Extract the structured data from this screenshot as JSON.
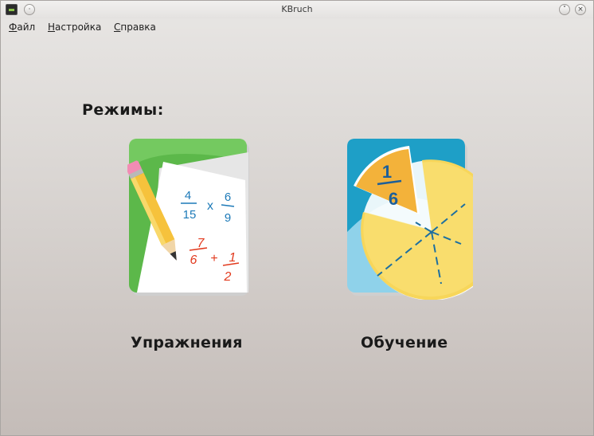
{
  "window": {
    "title": "KBruch"
  },
  "menu": {
    "items": [
      {
        "label": "Файл",
        "accel": "Ф",
        "rest": "айл"
      },
      {
        "label": "Настройка",
        "accel": "Н",
        "rest": "астройка"
      },
      {
        "label": "Справка",
        "accel": "С",
        "rest": "правка"
      }
    ]
  },
  "main": {
    "heading": "Режимы:",
    "modes": [
      {
        "label": "Упражнения",
        "icon": "exercise-pencil-paper-icon",
        "fractions": {
          "a_num": "4",
          "a_den": "15",
          "op1": "x",
          "b_num": "6",
          "b_den": "9",
          "c_num": "7",
          "c_den": "6",
          "op2": "+",
          "d_num": "1",
          "d_den": "2"
        }
      },
      {
        "label": "Обучение",
        "icon": "learning-pie-chart-icon",
        "fraction": {
          "num": "1",
          "den": "6"
        }
      }
    ]
  },
  "colors": {
    "exercise_bg": "#5cb84a",
    "learning_bg": "#1e9fc7",
    "pie": "#f7d65a",
    "fraction_red": "#e23b1f",
    "fraction_blue": "#1d7ab8"
  }
}
